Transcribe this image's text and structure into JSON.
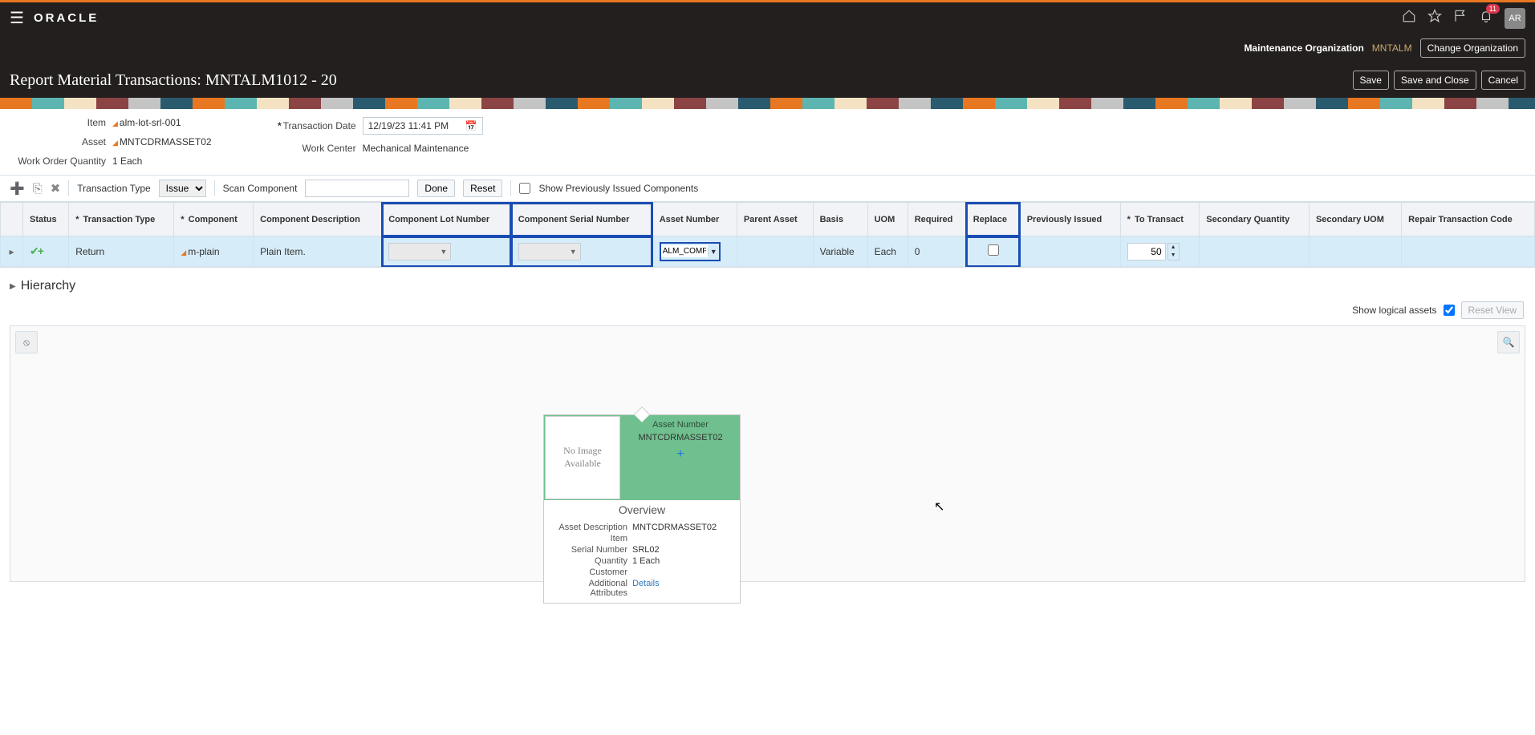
{
  "header": {
    "oracle": "ORACLE",
    "notif_count": "11",
    "avatar": "AR"
  },
  "subheader": {
    "maint_org_label": "Maintenance Organization",
    "maint_org_value": "MNTALM",
    "change_org": "Change Organization"
  },
  "title": "Report Material Transactions: MNTALM1012 - 20",
  "actions": {
    "save": "Save",
    "save_close": "Save and Close",
    "cancel": "Cancel"
  },
  "info": {
    "item_label": "Item",
    "item_value": "alm-lot-srl-001",
    "asset_label": "Asset",
    "asset_value": "MNTCDRMASSET02",
    "woq_label": "Work Order Quantity",
    "woq_value": "1 Each",
    "tdate_label": "Transaction Date",
    "tdate_value": "12/19/23 11:41 PM",
    "wc_label": "Work Center",
    "wc_value": "Mechanical Maintenance"
  },
  "toolbar": {
    "ttype_label": "Transaction Type",
    "ttype_value": "Issue",
    "scan_label": "Scan Component",
    "done": "Done",
    "reset": "Reset",
    "show_prev": "Show Previously Issued Components"
  },
  "columns": {
    "status": "Status",
    "ttype": "Transaction Type",
    "component": "Component",
    "cdesc": "Component Description",
    "clot": "Component Lot Number",
    "cserial": "Component Serial Number",
    "assetnum": "Asset Number",
    "parent": "Parent Asset",
    "basis": "Basis",
    "uom": "UOM",
    "required": "Required",
    "replace": "Replace",
    "prev": "Previously Issued",
    "totransact": "To Transact",
    "secqty": "Secondary Quantity",
    "secuom": "Secondary UOM",
    "repair": "Repair Transaction Code"
  },
  "row": {
    "ttype": "Return",
    "component": "m-plain",
    "cdesc": "Plain Item.",
    "assetnum": "ALM_COMP",
    "basis": "Variable",
    "uom": "Each",
    "required": "0",
    "totransact": "50"
  },
  "hierarchy": {
    "title": "Hierarchy",
    "show_logical": "Show logical assets",
    "reset_view": "Reset View"
  },
  "card": {
    "no_image": "No Image Available",
    "assetnum_label": "Asset Number",
    "assetnum_value": "MNTCDRMASSET02",
    "overview": "Overview",
    "desc_label": "Asset Description",
    "desc_value": "MNTCDRMASSET02",
    "item_label": "Item",
    "serial_label": "Serial Number",
    "serial_value": "SRL02",
    "qty_label": "Quantity",
    "qty_value": "1 Each",
    "cust_label": "Customer",
    "attr_label": "Additional Attributes",
    "attr_value": "Details"
  }
}
